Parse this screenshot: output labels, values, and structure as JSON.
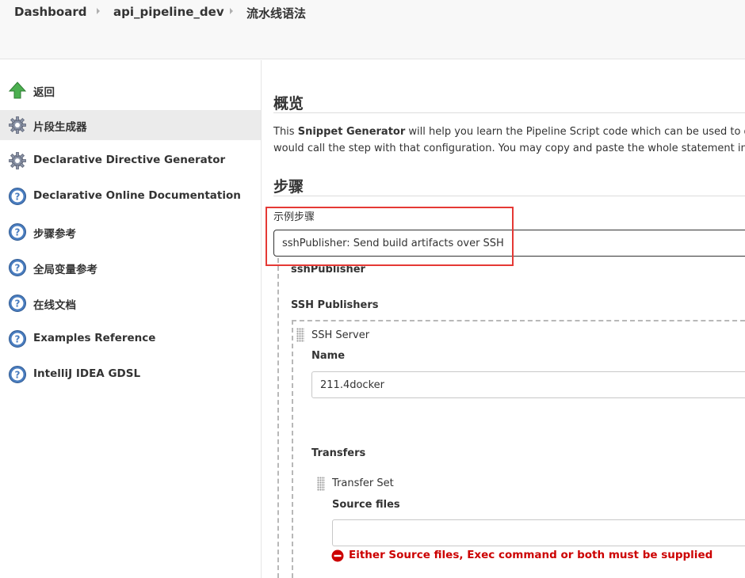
{
  "breadcrumb": {
    "items": [
      "Dashboard",
      "api_pipeline_dev",
      "流水线语法"
    ]
  },
  "sidebar": {
    "items": [
      {
        "label": "返回",
        "icon": "up-arrow-icon"
      },
      {
        "label": "片段生成器",
        "icon": "gear-icon",
        "active": true
      },
      {
        "label": "Declarative Directive Generator",
        "icon": "gear-icon"
      },
      {
        "label": "Declarative Online Documentation",
        "icon": "help-icon"
      },
      {
        "label": "步骤参考",
        "icon": "help-icon"
      },
      {
        "label": "全局变量参考",
        "icon": "help-icon"
      },
      {
        "label": "在线文档",
        "icon": "help-icon"
      },
      {
        "label": "Examples Reference",
        "icon": "help-icon"
      },
      {
        "label": "IntelliJ IDEA GDSL",
        "icon": "help-icon"
      }
    ]
  },
  "main": {
    "overview_title": "概览",
    "description": {
      "prefix": "This ",
      "bold": "Snippet Generator",
      "line1_rest": " will help you learn the Pipeline Script code which can be used to define",
      "line2": "would call the step with that configuration. You may copy and paste the whole statement into yo"
    },
    "steps_title": "步骤",
    "sample_step_label": "示例步骤",
    "sample_step_value": "sshPublisher: Send build artifacts over SSH",
    "step_name": "sshPublisher",
    "ssh_publishers_label": "SSH Publishers",
    "ssh_server_label": "SSH Server",
    "name_label": "Name",
    "name_value": "211.4docker",
    "transfers_label": "Transfers",
    "transfer_set_label": "Transfer Set",
    "source_files_label": "Source files",
    "source_files_value": "",
    "error_message": "Either Source files, Exec command or both must be supplied"
  },
  "colors": {
    "highlight_border": "#e53935",
    "error_text": "#cc0000",
    "help_icon": "#4a7dbf",
    "arrow_icon": "#4caf50"
  }
}
